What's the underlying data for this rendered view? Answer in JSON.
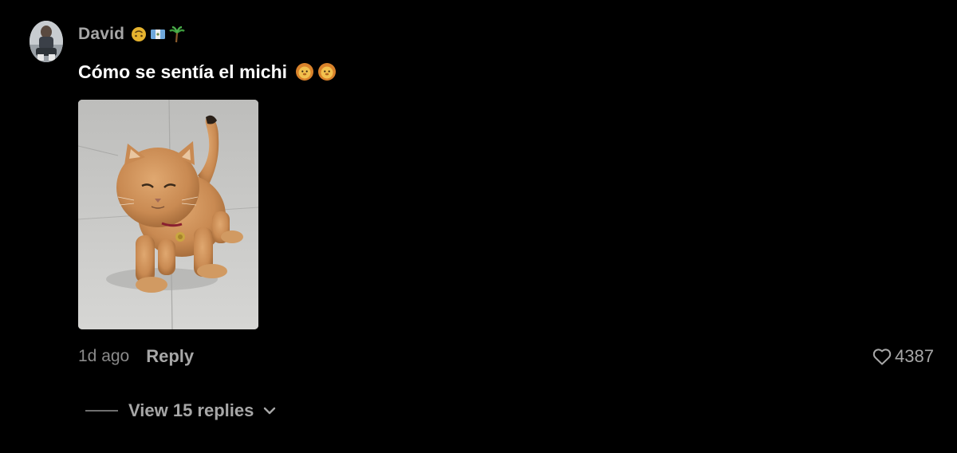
{
  "comment": {
    "username": "David",
    "username_flair_icons": [
      "upside-down-face-icon",
      "flag-icon",
      "palm-tree-icon"
    ],
    "text": "Cómo se sentía el michi",
    "text_emoji_icons": [
      "lion-face-icon",
      "lion-face-icon"
    ],
    "attached_image": "orange-kitten-photo",
    "timestamp": "1d ago",
    "reply_label": "Reply",
    "like_count": "4387",
    "view_replies_label": "View 15 replies"
  },
  "colors": {
    "background": "#000000",
    "primary_text": "#ffffff",
    "secondary_text": "#a7a7a7",
    "muted_text": "#8a8a8a"
  }
}
